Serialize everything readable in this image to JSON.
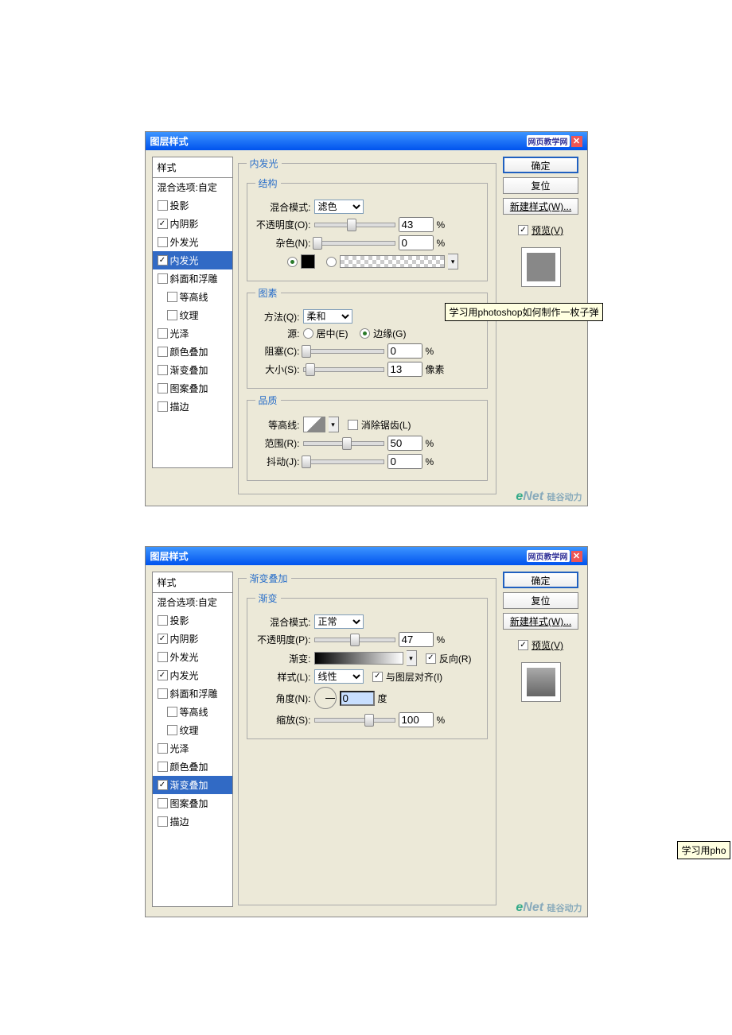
{
  "d1": {
    "title": "图层样式",
    "badge": "网页教学网",
    "close": "✕",
    "side_header": "样式",
    "blending": "混合选项:自定",
    "items": [
      {
        "l": "投影",
        "c": false
      },
      {
        "l": "内阴影",
        "c": true
      },
      {
        "l": "外发光",
        "c": false
      },
      {
        "l": "内发光",
        "c": true,
        "sel": true
      },
      {
        "l": "斜面和浮雕",
        "c": false
      },
      {
        "l": "等高线",
        "c": false,
        "i": true
      },
      {
        "l": "纹理",
        "c": false,
        "i": true
      },
      {
        "l": "光泽",
        "c": false
      },
      {
        "l": "颜色叠加",
        "c": false
      },
      {
        "l": "渐变叠加",
        "c": false
      },
      {
        "l": "图案叠加",
        "c": false
      },
      {
        "l": "描边",
        "c": false
      }
    ],
    "btn_ok": "确定",
    "btn_reset": "复位",
    "btn_new": "新建样式(W)...",
    "preview_label": "预览(V)",
    "group_main": "内发光",
    "g_struct": "结构",
    "blend_mode_l": "混合模式:",
    "blend_mode_v": "滤色",
    "opacity_l": "不透明度(O):",
    "opacity_v": "43",
    "pct": "%",
    "noise_l": "杂色(N):",
    "noise_v": "0",
    "g_elem": "图素",
    "method_l": "方法(Q):",
    "method_v": "柔和",
    "source_l": "源:",
    "src_center": "居中(E)",
    "src_edge": "边缘(G)",
    "choke_l": "阻塞(C):",
    "choke_v": "0",
    "size_l": "大小(S):",
    "size_v": "13",
    "px": "像素",
    "g_qual": "品质",
    "contour_l": "等高线:",
    "antialias": "消除锯齿(L)",
    "range_l": "范围(R):",
    "range_v": "50",
    "jitter_l": "抖动(J):",
    "jitter_v": "0",
    "tooltip": "学习用photoshop如何制作一枚子弹",
    "footer": "eNet 硅谷动力"
  },
  "d2": {
    "title": "图层样式",
    "badge": "网页教学网",
    "close": "✕",
    "side_header": "样式",
    "blending": "混合选项:自定",
    "items": [
      {
        "l": "投影",
        "c": false
      },
      {
        "l": "内阴影",
        "c": true
      },
      {
        "l": "外发光",
        "c": false
      },
      {
        "l": "内发光",
        "c": true
      },
      {
        "l": "斜面和浮雕",
        "c": false
      },
      {
        "l": "等高线",
        "c": false,
        "i": true
      },
      {
        "l": "纹理",
        "c": false,
        "i": true
      },
      {
        "l": "光泽",
        "c": false
      },
      {
        "l": "颜色叠加",
        "c": false
      },
      {
        "l": "渐变叠加",
        "c": true,
        "sel": true
      },
      {
        "l": "图案叠加",
        "c": false
      },
      {
        "l": "描边",
        "c": false
      }
    ],
    "btn_ok": "确定",
    "btn_reset": "复位",
    "btn_new": "新建样式(W)...",
    "preview_label": "预览(V)",
    "group_main": "渐变叠加",
    "g_grad": "渐变",
    "blend_mode_l": "混合模式:",
    "blend_mode_v": "正常",
    "opacity_l": "不透明度(P):",
    "opacity_v": "47",
    "pct": "%",
    "grad_l": "渐变:",
    "reverse": "反向(R)",
    "style_l": "样式(L):",
    "style_v": "线性",
    "align": "与图层对齐(I)",
    "angle_l": "角度(N):",
    "angle_v": "0",
    "deg": "度",
    "scale_l": "缩放(S):",
    "scale_v": "100",
    "tooltip2": "学习用pho",
    "footer": "eNet 硅谷动力"
  }
}
